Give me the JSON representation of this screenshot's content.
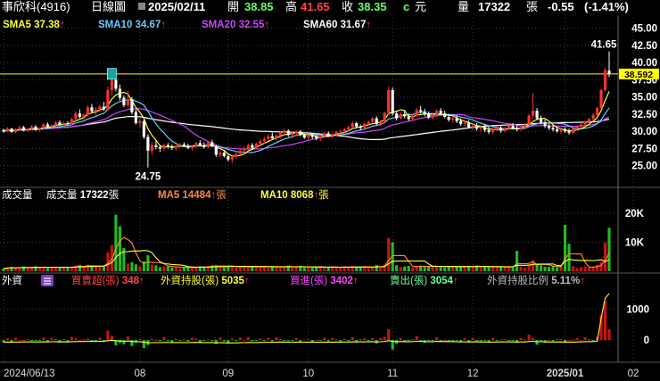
{
  "header": {
    "stock": "事欣科(4916)",
    "chart_kind": "日線圖",
    "date": "2025/02/11",
    "open_label": "開",
    "open": "38.85",
    "high_label": "高",
    "high": "41.65",
    "close_label": "收",
    "close": "38.35",
    "currency_mark": "c",
    "currency_unit": "元",
    "volume_label": "量",
    "volume": "17322",
    "volume_unit": "張",
    "change": "-0.55",
    "change_pct": "(-1.41%)"
  },
  "ma_legend": [
    {
      "label": "SMA5",
      "value": "37.38",
      "arrow": "↑",
      "color": "#ffff33"
    },
    {
      "label": "SMA10",
      "value": "34.67",
      "arrow": "↑",
      "color": "#66ccff"
    },
    {
      "label": "SMA20",
      "value": "32.55",
      "arrow": "↑",
      "color": "#cc44ff"
    },
    {
      "label": "SMA60",
      "value": "31.67",
      "arrow": "↑",
      "color": "#ffffff"
    }
  ],
  "volume_legend": {
    "title": "成交量",
    "items": [
      {
        "label": "成交量",
        "value": "17322",
        "unit": "張",
        "color": "#ffffff"
      },
      {
        "label": "MA5",
        "value": "14484",
        "arrow": "↑",
        "unit": "張",
        "color": "#ff8844"
      },
      {
        "label": "MA10",
        "value": "8068",
        "arrow": "↑",
        "unit": "張",
        "color": "#ffff33"
      }
    ]
  },
  "foreign_legend": {
    "title": "外資",
    "items": [
      {
        "label": "買賣超(張)",
        "value": "348",
        "arrow": "↑",
        "color": "#ff4444"
      },
      {
        "label": "外資持股(張)",
        "value": "5035",
        "arrow": "↑",
        "color": "#ffff33"
      },
      {
        "label": "買進(張)",
        "value": "3402",
        "arrow": "↑",
        "color": "#ff44ff"
      },
      {
        "label": "賣出(張)",
        "value": "3054",
        "arrow": "↑",
        "color": "#66ff99"
      },
      {
        "label": "外資持股比例",
        "value": "5.11%",
        "arrow": "↑",
        "color": "#bbbbbb"
      }
    ]
  },
  "colors": {
    "up": "#ff3030",
    "down": "#ffffff",
    "vol_up": "#cc1111",
    "vol_down": "#22bb22",
    "grid": "#3a3a3a",
    "hline": "#ffff00",
    "close_tag_bg": "#ffff00"
  },
  "chart_data": {
    "type": "candlestick",
    "x_ticks": [
      "2024/06/13",
      "08",
      "09",
      "10",
      "11",
      "12",
      "2025/01",
      "02"
    ],
    "price_axis": {
      "ticks": [
        25,
        27.5,
        30,
        32.5,
        35,
        37.5,
        40,
        42.5,
        45
      ],
      "labels": [
        "25.00",
        "27.50",
        "30.00",
        "32.50",
        "35.00",
        "37.50",
        "40.00",
        "42.50",
        "45.00"
      ],
      "range": [
        22.5,
        46
      ]
    },
    "volume_axis": {
      "ticks": [
        10000,
        20000
      ],
      "labels": [
        "10K",
        "20K"
      ],
      "range": [
        0,
        24000
      ]
    },
    "foreign_axis": {
      "ticks": [
        0,
        1000
      ],
      "labels": [
        "0",
        "1000"
      ],
      "range": [
        -600,
        1700
      ]
    },
    "current_close_tag": "38.592",
    "annotations": [
      {
        "label": "41.65",
        "kind": "high"
      },
      {
        "label": "24.75",
        "kind": "low"
      }
    ],
    "month_positions": [
      0,
      34,
      56,
      76,
      97,
      117,
      140,
      157
    ],
    "candles": [
      [
        30.2,
        30.4,
        29.8,
        30.0
      ],
      [
        30.0,
        30.6,
        29.9,
        30.4
      ],
      [
        30.4,
        30.5,
        29.8,
        29.9
      ],
      [
        29.9,
        30.4,
        29.7,
        30.3
      ],
      [
        30.3,
        30.8,
        30.1,
        30.6
      ],
      [
        30.6,
        30.8,
        30.0,
        30.1
      ],
      [
        30.1,
        30.5,
        29.9,
        30.4
      ],
      [
        30.4,
        30.9,
        30.2,
        30.7
      ],
      [
        30.7,
        30.9,
        30.1,
        30.2
      ],
      [
        30.2,
        30.6,
        30.0,
        30.5
      ],
      [
        30.5,
        31.2,
        30.3,
        31.0
      ],
      [
        31.0,
        31.3,
        30.5,
        30.7
      ],
      [
        30.7,
        31.0,
        30.3,
        30.9
      ],
      [
        30.9,
        31.5,
        30.7,
        31.3
      ],
      [
        31.3,
        31.6,
        30.8,
        31.0
      ],
      [
        31.0,
        31.4,
        30.6,
        31.2
      ],
      [
        31.2,
        31.5,
        30.9,
        31.1
      ],
      [
        31.1,
        32.0,
        31.0,
        31.8
      ],
      [
        31.8,
        32.9,
        31.5,
        32.6
      ],
      [
        32.6,
        33.2,
        31.9,
        32.1
      ],
      [
        32.1,
        32.6,
        31.7,
        32.4
      ],
      [
        32.4,
        33.8,
        32.2,
        33.5
      ],
      [
        33.5,
        34.0,
        32.6,
        32.9
      ],
      [
        32.9,
        33.5,
        32.3,
        33.2
      ],
      [
        33.2,
        33.9,
        32.8,
        33.6
      ],
      [
        33.6,
        34.3,
        33.0,
        33.2
      ],
      [
        33.2,
        36.5,
        33.0,
        36.0
      ],
      [
        36.0,
        38.2,
        35.2,
        37.5
      ],
      [
        37.5,
        38.0,
        35.8,
        36.2
      ],
      [
        36.2,
        36.8,
        34.5,
        34.9
      ],
      [
        34.9,
        35.2,
        33.5,
        33.8
      ],
      [
        33.8,
        35.9,
        33.6,
        34.7
      ],
      [
        34.7,
        35.0,
        32.5,
        32.8
      ],
      [
        32.8,
        33.2,
        31.0,
        31.2
      ],
      [
        31.2,
        31.8,
        30.6,
        31.5
      ],
      [
        31.5,
        31.7,
        28.9,
        29.2
      ],
      [
        29.2,
        29.6,
        24.75,
        27.2
      ],
      [
        27.2,
        28.4,
        26.6,
        28.0
      ],
      [
        28.0,
        28.6,
        27.4,
        27.7
      ],
      [
        27.7,
        28.0,
        27.0,
        27.5
      ],
      [
        27.5,
        28.2,
        27.2,
        28.0
      ],
      [
        28.0,
        28.3,
        27.5,
        27.8
      ],
      [
        27.8,
        28.1,
        27.3,
        27.6
      ],
      [
        27.6,
        28.0,
        27.2,
        27.9
      ],
      [
        27.9,
        28.3,
        27.6,
        28.1
      ],
      [
        28.1,
        28.4,
        27.7,
        27.9
      ],
      [
        27.9,
        28.2,
        27.4,
        27.6
      ],
      [
        27.6,
        28.0,
        27.2,
        27.8
      ],
      [
        27.8,
        28.5,
        27.6,
        28.3
      ],
      [
        28.3,
        28.7,
        27.9,
        28.0
      ],
      [
        28.0,
        28.4,
        27.5,
        27.7
      ],
      [
        27.7,
        28.6,
        27.5,
        28.4
      ],
      [
        28.4,
        28.8,
        27.7,
        27.8
      ],
      [
        27.8,
        28.0,
        26.3,
        26.6
      ],
      [
        26.6,
        27.2,
        26.2,
        26.9
      ],
      [
        26.9,
        27.3,
        26.2,
        26.4
      ],
      [
        26.4,
        26.8,
        25.6,
        25.9
      ],
      [
        25.9,
        26.6,
        25.4,
        26.3
      ],
      [
        26.3,
        26.9,
        26.0,
        26.7
      ],
      [
        26.7,
        27.4,
        26.5,
        27.2
      ],
      [
        27.2,
        27.8,
        26.9,
        27.5
      ],
      [
        27.5,
        28.2,
        27.2,
        28.0
      ],
      [
        28.0,
        28.3,
        27.3,
        27.6
      ],
      [
        27.6,
        28.4,
        27.4,
        28.2
      ],
      [
        28.2,
        28.9,
        27.9,
        28.6
      ],
      [
        28.6,
        29.2,
        28.2,
        28.9
      ],
      [
        28.9,
        29.6,
        28.6,
        29.3
      ],
      [
        29.3,
        29.8,
        28.8,
        29.0
      ],
      [
        29.0,
        29.6,
        28.7,
        29.4
      ],
      [
        29.4,
        30.0,
        29.0,
        29.8
      ],
      [
        29.8,
        30.4,
        29.5,
        30.1
      ],
      [
        30.1,
        30.3,
        29.2,
        29.5
      ],
      [
        29.5,
        29.9,
        29.0,
        29.7
      ],
      [
        29.7,
        30.2,
        29.4,
        30.0
      ],
      [
        30.0,
        30.2,
        29.3,
        29.5
      ],
      [
        29.5,
        29.7,
        28.9,
        29.1
      ],
      [
        29.1,
        29.6,
        28.8,
        29.4
      ],
      [
        29.4,
        29.8,
        28.9,
        29.2
      ],
      [
        29.2,
        29.5,
        28.7,
        29.0
      ],
      [
        29.0,
        29.4,
        28.6,
        29.3
      ],
      [
        29.3,
        29.9,
        29.1,
        29.7
      ],
      [
        29.7,
        30.0,
        29.2,
        29.4
      ],
      [
        29.4,
        29.8,
        29.0,
        29.6
      ],
      [
        29.6,
        30.1,
        29.3,
        29.9
      ],
      [
        29.9,
        30.3,
        29.6,
        30.0
      ],
      [
        30.0,
        30.5,
        29.8,
        30.3
      ],
      [
        30.3,
        30.8,
        30.0,
        30.6
      ],
      [
        30.6,
        31.5,
        30.4,
        31.2
      ],
      [
        31.2,
        31.4,
        30.4,
        30.7
      ],
      [
        30.7,
        31.0,
        30.2,
        30.5
      ],
      [
        30.5,
        31.3,
        30.3,
        31.1
      ],
      [
        31.1,
        31.6,
        30.8,
        31.4
      ],
      [
        31.4,
        32.1,
        31.2,
        31.9
      ],
      [
        31.9,
        32.2,
        30.9,
        31.1
      ],
      [
        31.1,
        31.6,
        30.8,
        31.4
      ],
      [
        31.4,
        32.9,
        31.2,
        32.7
      ],
      [
        32.7,
        36.5,
        32.5,
        36.0
      ],
      [
        36.0,
        36.4,
        32.3,
        32.6
      ],
      [
        32.6,
        33.0,
        31.6,
        31.9
      ],
      [
        31.9,
        32.8,
        31.7,
        32.5
      ],
      [
        32.5,
        33.0,
        31.9,
        32.2
      ],
      [
        32.2,
        32.6,
        31.5,
        31.8
      ],
      [
        31.8,
        32.5,
        31.6,
        32.3
      ],
      [
        32.3,
        33.4,
        32.1,
        33.1
      ],
      [
        33.1,
        33.7,
        32.6,
        32.9
      ],
      [
        32.9,
        33.3,
        32.2,
        32.5
      ],
      [
        32.5,
        32.9,
        31.8,
        32.0
      ],
      [
        32.0,
        32.7,
        31.7,
        32.4
      ],
      [
        32.4,
        33.2,
        32.2,
        33.0
      ],
      [
        33.0,
        33.4,
        32.3,
        32.6
      ],
      [
        32.6,
        33.0,
        31.9,
        32.1
      ],
      [
        32.1,
        32.5,
        31.4,
        31.7
      ],
      [
        31.7,
        32.2,
        31.3,
        31.9
      ],
      [
        31.9,
        32.3,
        31.2,
        31.5
      ],
      [
        31.5,
        31.9,
        30.8,
        31.1
      ],
      [
        31.1,
        31.6,
        30.7,
        31.3
      ],
      [
        31.3,
        31.6,
        30.4,
        30.6
      ],
      [
        30.6,
        31.1,
        30.2,
        30.8
      ],
      [
        30.8,
        31.2,
        30.1,
        30.4
      ],
      [
        30.4,
        30.9,
        30.0,
        30.6
      ],
      [
        30.6,
        31.0,
        29.9,
        30.2
      ],
      [
        30.2,
        30.7,
        29.6,
        29.9
      ],
      [
        29.9,
        30.5,
        29.6,
        30.3
      ],
      [
        30.3,
        30.8,
        30.0,
        30.5
      ],
      [
        30.5,
        30.9,
        29.8,
        30.1
      ],
      [
        30.1,
        30.6,
        29.8,
        30.4
      ],
      [
        30.4,
        31.0,
        30.2,
        30.8
      ],
      [
        30.8,
        31.2,
        30.3,
        30.5
      ],
      [
        30.5,
        30.9,
        30.0,
        30.3
      ],
      [
        30.3,
        30.8,
        30.1,
        30.6
      ],
      [
        30.6,
        31.2,
        30.4,
        31.0
      ],
      [
        31.0,
        32.5,
        30.8,
        32.3
      ],
      [
        32.3,
        35.6,
        31.8,
        33.0
      ],
      [
        33.0,
        33.4,
        31.6,
        31.9
      ],
      [
        31.9,
        32.3,
        31.0,
        31.3
      ],
      [
        31.3,
        31.7,
        30.5,
        30.8
      ],
      [
        30.8,
        31.1,
        30.2,
        30.5
      ],
      [
        30.5,
        30.9,
        30.0,
        30.3
      ],
      [
        30.3,
        30.7,
        29.8,
        30.0
      ],
      [
        30.0,
        30.5,
        29.7,
        30.3
      ],
      [
        30.3,
        30.6,
        29.8,
        30.0
      ],
      [
        30.0,
        30.4,
        29.5,
        29.8
      ],
      [
        29.8,
        30.6,
        29.6,
        30.4
      ],
      [
        30.4,
        30.9,
        30.1,
        30.7
      ],
      [
        30.7,
        31.2,
        30.4,
        31.0
      ],
      [
        31.0,
        31.6,
        30.7,
        31.4
      ],
      [
        31.4,
        32.0,
        31.1,
        31.8
      ],
      [
        31.8,
        32.6,
        31.6,
        32.4
      ],
      [
        32.4,
        33.6,
        32.2,
        33.4
      ],
      [
        33.4,
        36.2,
        33.2,
        36.0
      ],
      [
        36.0,
        39.2,
        35.8,
        38.9
      ],
      [
        38.85,
        41.65,
        37.9,
        38.35
      ]
    ],
    "ma": {
      "SMA5": {
        "color": "#ffff33",
        "last": 37.38
      },
      "SMA10": {
        "color": "#66ccff",
        "last": 34.67
      },
      "SMA20": {
        "color": "#cc44ff",
        "last": 32.55
      },
      "SMA60": {
        "color": "#ffffff",
        "last": 31.67
      }
    },
    "volume_highlights": {
      "28": 19500,
      "29": 15500,
      "27": 9000,
      "26": 6500,
      "30": 8000,
      "36": 5500,
      "96": 11500,
      "97": 10000,
      "140": 16000,
      "141": 9500,
      "150": 9800,
      "151": 15000,
      "152": 17322,
      "128": 7000
    }
  }
}
